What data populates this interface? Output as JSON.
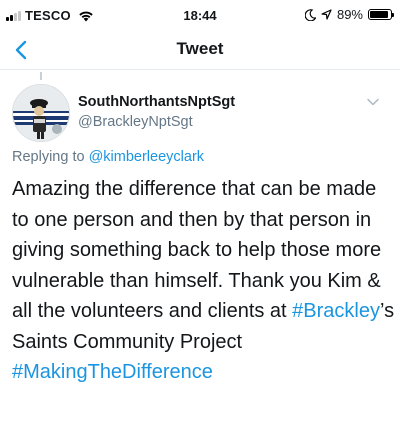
{
  "status_bar": {
    "carrier": "TESCO",
    "time": "18:44",
    "battery": "89%",
    "battery_level": 0.89
  },
  "nav": {
    "title": "Tweet"
  },
  "tweet": {
    "display_name": "SouthNorthantsNptSgt",
    "handle": "@BrackleyNptSgt",
    "reply_prefix": "Replying to",
    "reply_to": "@kimberleeyclark",
    "text_part1": "Amazing the difference that can be made to one person and then by that person in giving something back to help those more vulnerable than himself. Thank you Kim & all the volunteers and clients at ",
    "hashtag1": "#Brackley",
    "text_part2": "’s Saints Community Project ",
    "hashtag2": "#MakingTheDifference"
  },
  "colors": {
    "link": "#1b95e0",
    "secondary_text": "#657786",
    "text": "#14171a"
  }
}
